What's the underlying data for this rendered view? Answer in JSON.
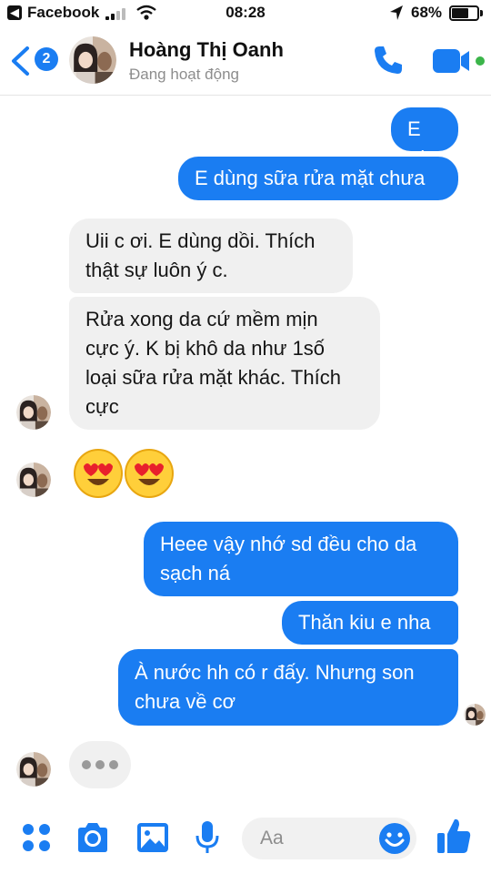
{
  "status_bar": {
    "back_app": "Facebook",
    "time": "08:28",
    "battery_text": "68%",
    "battery_level": 0.68
  },
  "header": {
    "back_badge": "2",
    "contact_name": "Hoàng Thị Oanh",
    "contact_status": "Đang hoạt động"
  },
  "messages": [
    {
      "from": "me",
      "lines": [
        "E ơi"
      ]
    },
    {
      "from": "me",
      "lines": [
        "E dùng sữa rửa mặt chưa"
      ]
    },
    {
      "from": "them",
      "lines": [
        "Uii c ơi. E dùng dồi. Thích",
        "thật sự luôn ý c."
      ]
    },
    {
      "from": "them",
      "lines": [
        "Rửa xong da cứ mềm mịn",
        "cực ý. K bị khô da như 1số",
        "loại sữa rửa mặt khác. Thích",
        "cực"
      ]
    },
    {
      "from": "them",
      "type": "emoji",
      "emoji": "heart-eyes-emoji",
      "count": 2
    },
    {
      "from": "me",
      "lines": [
        "Heee vậy nhớ sd đều cho da",
        "sạch ná"
      ]
    },
    {
      "from": "me",
      "lines": [
        "Thăn kiu e nha"
      ]
    },
    {
      "from": "me",
      "lines": [
        "À nước hh có r đấy. Nhưng son",
        "chưa về cơ"
      ]
    }
  ],
  "composer": {
    "placeholder": "Aa"
  },
  "colors": {
    "accent": "#1a7df2",
    "incoming_bubble": "#f0f0f0",
    "online": "#3bb54a"
  },
  "icons": [
    "more-apps-icon",
    "camera-icon",
    "gallery-icon",
    "microphone-icon",
    "emoji-icon",
    "thumbs-up-icon",
    "phone-icon",
    "video-icon",
    "back-chevron-icon"
  ]
}
